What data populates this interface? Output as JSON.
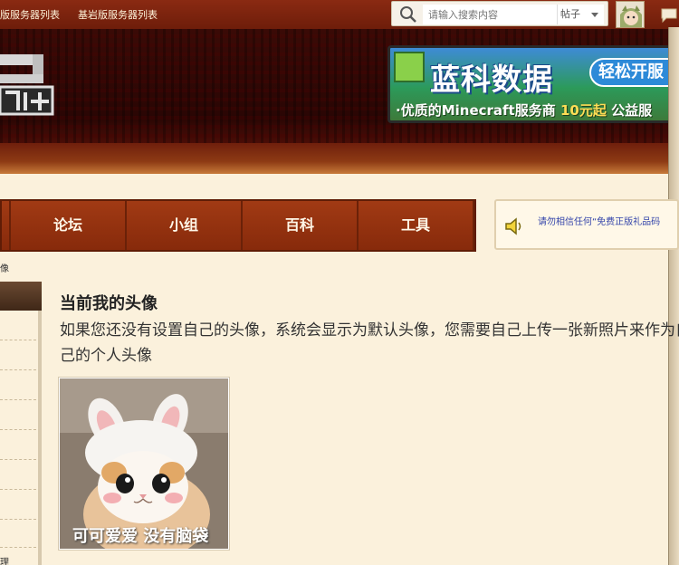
{
  "topbar": {
    "link_java": "版服务器列表",
    "link_bedrock": "基岩版服务器列表",
    "search_placeholder": "请输入搜索内容",
    "search_type": "帖子"
  },
  "banner": {
    "title": "蓝科数据",
    "cta": "轻松开服",
    "sub_prefix": "·优质的Minecraft服务商",
    "sub_price": "10元起",
    "sub_suffix": "公益服"
  },
  "nav": {
    "items": [
      "论坛",
      "小组",
      "百科",
      "工具"
    ]
  },
  "notice": {
    "text": "请勿相信任何“免费正版礼品码"
  },
  "breadcrumb": {
    "tail": "像"
  },
  "sidebar": {
    "bottom_text": "理"
  },
  "main": {
    "title": "当前我的头像",
    "desc": "如果您还没有设置自己的头像，系统会显示为默认头像，您需要自己上传一张新照片来作为自己的个人头像",
    "avatar_caption": "可可爱爱 没有脑袋"
  },
  "colors": {
    "topbar": "#7a230e",
    "nav": "#8e2f0d",
    "page_bg": "#fbf1dc",
    "notice_text": "#3344aa"
  }
}
